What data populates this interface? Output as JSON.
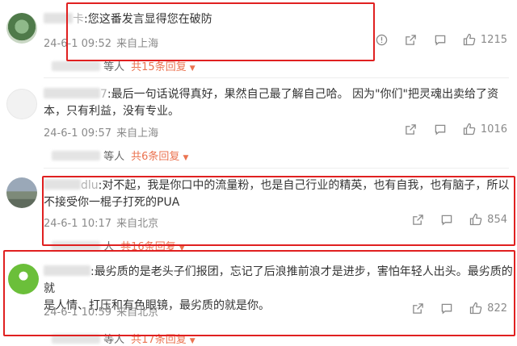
{
  "comments": [
    {
      "user_visible": "卡",
      "text": ":您这番发言显得您在破防",
      "date": "24-6-1 09:52",
      "location": "来自上海",
      "likes": "1215",
      "reply_users": "等人",
      "reply_count": "共15条回复",
      "has_report_icon": true
    },
    {
      "user_visible": "7",
      "text_line1": ":最后一句话说得真好，果然自己最了解自己哈。 因为\"你们\"把灵魂出卖给了资",
      "text_line2": "本，只有利益，没有专业。",
      "date": "24-6-1 09:57",
      "location": "来自上海",
      "likes": "1016",
      "reply_users": "等人",
      "reply_count": "共6条回复"
    },
    {
      "user_visible": "dlu",
      "text_line1": ":对不起，我是你口中的流量粉，也是自己行业的精英，也有自我，也有脑子，所以",
      "text_line2": "不接受你一棍子打死的PUA",
      "date": "24-6-1 10:17",
      "location": "来自北京",
      "likes": "854",
      "reply_users": "人",
      "reply_count": "共16条回复"
    },
    {
      "user_visible": "",
      "text_line1": ":最劣质的是老头子们报团，忘记了后浪推前浪才是进步，害怕年轻人出头。最劣质的就",
      "text_line2": "是人情、打压和有色眼镜，最劣质的就是你。",
      "date": "24-6-1 10:59",
      "location": "来自北京",
      "likes": "822",
      "reply_users": "等人",
      "reply_count": "共17条回复"
    }
  ],
  "colors": {
    "highlight_box": "#e02020",
    "reply_accent": "#eb7350",
    "meta_text": "#8a8a8a"
  },
  "icons": [
    "report-icon",
    "share-icon",
    "comment-icon",
    "like-icon",
    "caret-down-icon"
  ]
}
